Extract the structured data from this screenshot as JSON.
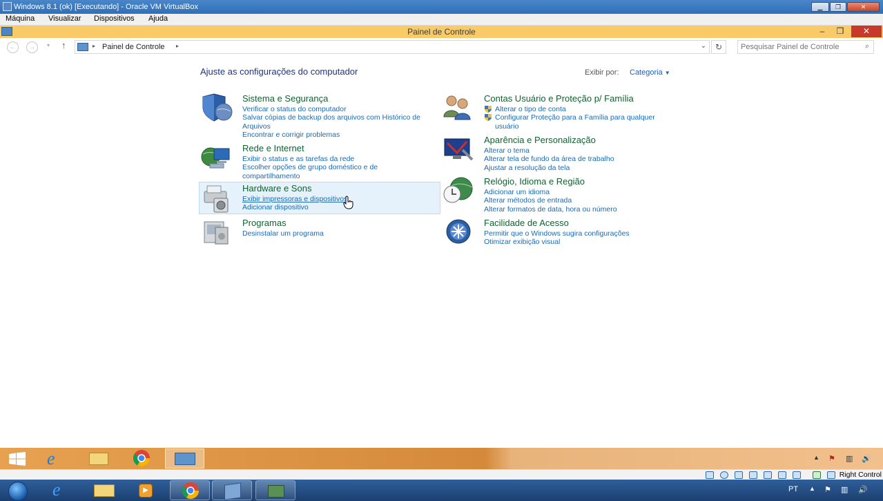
{
  "host": {
    "title": "Windows 8.1 (ok) [Executando] - Oracle VM VirtualBox",
    "menu": [
      "Máquina",
      "Visualizar",
      "Dispositivos",
      "Ajuda"
    ],
    "status_right": "Right Control",
    "tray_lang": "PT"
  },
  "window": {
    "title": "Painel de Controle"
  },
  "address": {
    "crumb": "Painel de Controle",
    "search_placeholder": "Pesquisar Painel de Controle"
  },
  "content": {
    "heading": "Ajuste as configurações do computador",
    "view_by_label": "Exibir por:",
    "view_by_value": "Categoria"
  },
  "categories": [
    {
      "title": "Sistema e Segurança",
      "icon": "shield-globe-icon",
      "links": [
        "Verificar o status do computador",
        "Salvar cópias de backup dos arquivos com Histórico de Arquivos",
        "Encontrar e corrigir problemas"
      ]
    },
    {
      "title": "Rede e Internet",
      "icon": "network-globe-icon",
      "links": [
        "Exibir o status e as tarefas da rede",
        "Escolher opções de grupo doméstico e de compartilhamento"
      ]
    },
    {
      "title": "Hardware e Sons",
      "icon": "printer-speaker-icon",
      "links": [
        "Exibir impressoras e dispositivos",
        "Adicionar dispositivo"
      ]
    },
    {
      "title": "Programas",
      "icon": "programs-icon",
      "links": [
        "Desinstalar um programa"
      ]
    },
    {
      "title": "Contas Usuário e Proteção p/ Família",
      "icon": "users-icon",
      "links": [
        "Alterar o tipo de conta",
        "Configurar Proteção para a Família para qualquer usuário"
      ]
    },
    {
      "title": "Aparência e Personalização",
      "icon": "monitor-paint-icon",
      "links": [
        "Alterar o tema",
        "Alterar tela de fundo da área de trabalho",
        "Ajustar a resolução da tela"
      ]
    },
    {
      "title": "Relógio, Idioma e Região",
      "icon": "clock-globe-icon",
      "links": [
        "Adicionar um idioma",
        "Alterar métodos de entrada",
        "Alterar formatos de data, hora ou número"
      ]
    },
    {
      "title": "Facilidade de Acesso",
      "icon": "ease-of-access-icon",
      "links": [
        "Permitir que o Windows sugira configurações",
        "Otimizar exibição visual"
      ]
    }
  ]
}
